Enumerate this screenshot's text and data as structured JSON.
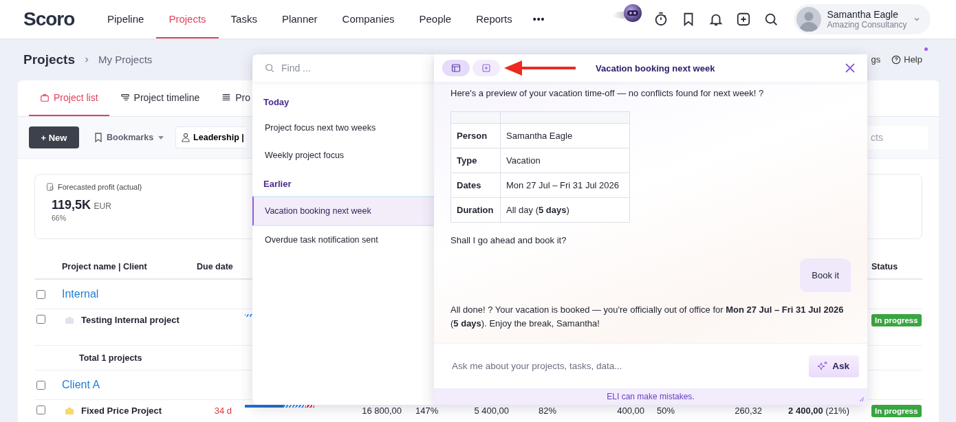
{
  "nav": {
    "logo": "Scoro",
    "items": [
      {
        "label": "Pipeline",
        "selected": false
      },
      {
        "label": "Projects",
        "selected": true
      },
      {
        "label": "Tasks",
        "selected": false
      },
      {
        "label": "Planner",
        "selected": false
      },
      {
        "label": "Companies",
        "selected": false
      },
      {
        "label": "People",
        "selected": false
      },
      {
        "label": "Reports",
        "selected": false
      }
    ],
    "more": "•••",
    "user": {
      "name": "Samantha Eagle",
      "company": "Amazing Consultancy"
    }
  },
  "page": {
    "title": "Projects",
    "breadcrumb": "My Projects",
    "settings_link": "gs",
    "help": "Help",
    "help_badge": true
  },
  "tabs": [
    {
      "label": "Project list",
      "selected": true
    },
    {
      "label": "Project timeline",
      "selected": false
    },
    {
      "label": "Pro",
      "selected": false
    }
  ],
  "toolbar": {
    "new_button": "+ New",
    "bookmarks": "Bookmarks",
    "view": "Leadership |",
    "search_placeholder": "cts"
  },
  "kpi": {
    "label": "Forecasted profit (actual)",
    "value": "119,5K",
    "unit": "EUR",
    "percent": "66%"
  },
  "table": {
    "columns": {
      "name": "Project name | Client",
      "due": "Due date",
      "status": "Status"
    },
    "rows": [
      {
        "kind": "group",
        "name": "Internal",
        "checked": false
      },
      {
        "kind": "project",
        "name": "Testing Internal project",
        "color": "#dde2ee",
        "checked": false,
        "status": "In progress"
      },
      {
        "kind": "total",
        "name": "Total 1 projects"
      },
      {
        "kind": "group",
        "name": "Client A",
        "checked": false
      },
      {
        "kind": "project",
        "name": "Fixed Price Project",
        "color": "#f6d96b",
        "checked": false,
        "due": "34 d",
        "overdue": true,
        "level": 0.55,
        "cells": [
          "16 800,00",
          "147%",
          "5 400,00",
          "82%",
          "400,00",
          "50%",
          "260,32",
          "**2 400,00** (21%)"
        ],
        "status": "In progress"
      }
    ]
  },
  "history": {
    "placeholder": "Find ...",
    "sections": [
      {
        "title": "Today",
        "items": [
          {
            "label": "Project focus next two weeks",
            "selected": false
          },
          {
            "label": "Weekly project focus",
            "selected": false
          }
        ]
      },
      {
        "title": "Earlier",
        "items": [
          {
            "label": "Vacation booking next week",
            "selected": true
          },
          {
            "label": "Overdue task notification sent",
            "selected": false
          }
        ]
      }
    ]
  },
  "chat": {
    "header_buttons": [
      {
        "kind": "layout",
        "selected": true
      },
      {
        "kind": "new",
        "selected": false
      }
    ],
    "title": "Vacation booking next week",
    "messages": [
      {
        "kind": "bot",
        "text": "Here's a preview of your vacation time-off — no conflicts found for next week! ?"
      },
      {
        "kind": "table",
        "rows": [
          {
            "label": "Person",
            "value": "Samantha Eagle"
          },
          {
            "label": "Type",
            "value": "Vacation"
          },
          {
            "label": "Dates",
            "value": "Mon 27 Jul – Fri 31 Jul 2026"
          },
          {
            "label": "Duration",
            "value": "All day (**5 days**)"
          }
        ]
      },
      {
        "kind": "bot",
        "text": "Shall I go ahead and book it?"
      },
      {
        "kind": "user",
        "text": "Book it"
      },
      {
        "kind": "bot",
        "text": "All done! ? Your vacation is booked — you're officially out of office for **Mon 27 Jul – Fri 31 Jul 2026** (**5 days**). Enjoy the break, Samantha!"
      }
    ],
    "input_placeholder": "Ask me about your projects, tasks, data...",
    "ask_button": "Ask",
    "disclaimer": "ELI can make mistakes."
  }
}
